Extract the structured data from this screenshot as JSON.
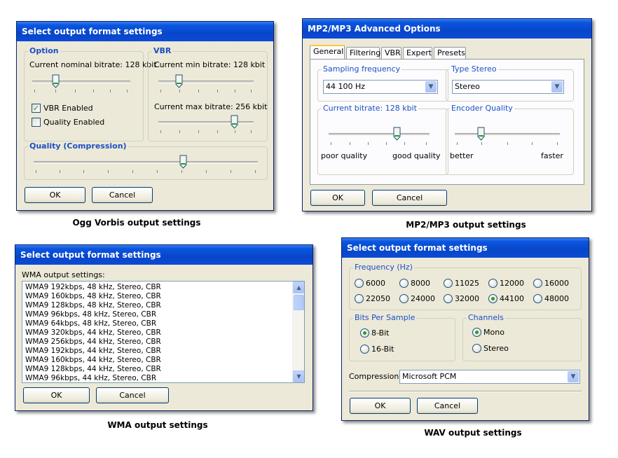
{
  "ogg": {
    "title": "Select output format settings",
    "option_legend": "Option",
    "nominal_label": "Current nominal bitrate: 128 kbit",
    "vbr_enabled": "VBR Enabled",
    "quality_enabled": "Quality Enabled",
    "vbr_legend": "VBR",
    "min_label": "Current min bitrate: 128 kbit",
    "max_label": "Current max bitrate: 256 kbit",
    "quality_legend": "Quality (Compression)",
    "ok": "OK",
    "cancel": "Cancel",
    "caption": "Ogg Vorbis output settings"
  },
  "mp3": {
    "title": "MP2/MP3 Advanced Options",
    "tabs": [
      "General",
      "Filtering",
      "VBR",
      "Expert",
      "Presets"
    ],
    "sampling_legend": "Sampling frequency",
    "sampling_value": "44 100 Hz",
    "stereo_legend": "Type Stereo",
    "stereo_value": "Stereo",
    "bitrate_legend": "Current bitrate: 128 kbit",
    "poor": "poor quality",
    "good": "good quality",
    "encoder_legend": "Encoder Quality",
    "better": "better",
    "faster": "faster",
    "ok": "OK",
    "cancel": "Cancel",
    "caption": "MP2/MP3 output settings"
  },
  "wma": {
    "title": "Select output format settings",
    "list_label": "WMA output settings:",
    "items": [
      "WMA9 192kbps, 48 kHz, Stereo, CBR",
      "WMA9 160kbps, 48 kHz, Stereo, CBR",
      "WMA9 128kbps, 48 kHz, Stereo, CBR",
      "WMA9 96kbps, 48 kHz, Stereo, CBR",
      "WMA9 64kbps, 48 kHz, Stereo, CBR",
      "WMA9 320kbps, 44 kHz, Stereo, CBR",
      "WMA9 256kbps, 44 kHz, Stereo, CBR",
      "WMA9 192kbps, 44 kHz, Stereo, CBR",
      "WMA9 160kbps, 44 kHz, Stereo, CBR",
      "WMA9 128kbps, 44 kHz, Stereo, CBR",
      "WMA9 96kbps, 44 kHz, Stereo, CBR"
    ],
    "ok": "OK",
    "cancel": "Cancel",
    "caption": "WMA output settings"
  },
  "wav": {
    "title": "Select output format settings",
    "freq_legend": "Frequency (Hz)",
    "freqs": [
      "6000",
      "8000",
      "11025",
      "12000",
      "16000",
      "22050",
      "24000",
      "32000",
      "44100",
      "48000"
    ],
    "freq_selected": "44100",
    "bits_legend": "Bits Per Sample",
    "bit8": "8-Bit",
    "bit16": "16-Bit",
    "channels_legend": "Channels",
    "mono": "Mono",
    "stereo": "Stereo",
    "compression_label": "Compression:",
    "compression_value": "Microsoft PCM",
    "ok": "OK",
    "cancel": "Cancel",
    "caption": "WAV output settings"
  },
  "colors": {
    "title_bar": "#0846c8",
    "legend_blue": "#1b4fc4",
    "dialog_bg": "#ece9d8"
  },
  "icons": {
    "check": "checkmark-icon",
    "dropdown": "chevron-down-icon",
    "scroll_up": "chevron-up-icon",
    "scroll_down": "chevron-down-icon"
  }
}
